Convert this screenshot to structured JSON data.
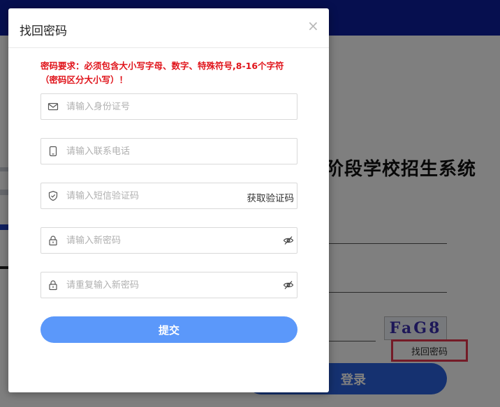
{
  "background": {
    "system_title": "阶段学校招生系统",
    "captcha_text": "FaG8",
    "forgot_link": "找回密码",
    "login_button": "登录"
  },
  "modal": {
    "title": "找回密码",
    "close_glyph": "×",
    "requirement": "密码要求：必须包含大小写字母、数字、特殊符号,8-16个字符（密码区分大小写）！",
    "fields": {
      "id_card": {
        "placeholder": "请输入身份证号",
        "value": "",
        "icon": "mail-icon"
      },
      "phone": {
        "placeholder": "请输入联系电话",
        "value": "",
        "icon": "phone-icon"
      },
      "sms_code": {
        "placeholder": "请输入短信验证码",
        "value": "",
        "icon": "shield-icon",
        "action": "获取验证码"
      },
      "new_password": {
        "placeholder": "请输入新密码",
        "value": "",
        "icon": "lock-icon"
      },
      "confirm_password": {
        "placeholder": "请重复输入新密码",
        "value": "",
        "icon": "lock-icon"
      }
    },
    "submit_label": "提交"
  },
  "colors": {
    "header_blue": "#0d1f9e",
    "submit_blue": "#5b98fa",
    "warning_red": "#e0141b",
    "highlight_red": "#e8364f"
  }
}
